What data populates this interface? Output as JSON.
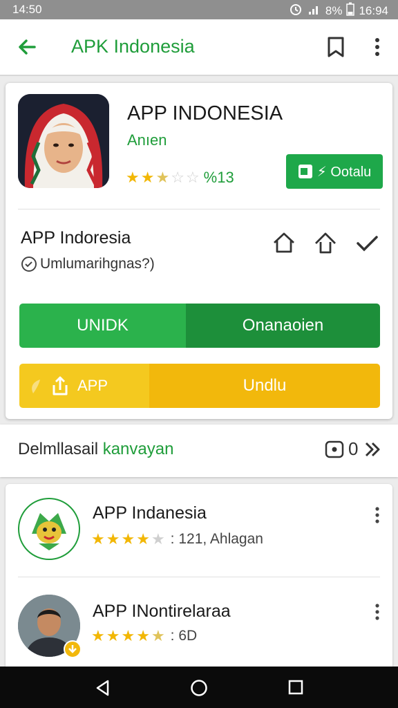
{
  "status_bar": {
    "time_left": "14:50",
    "battery": "8%",
    "time_right": "16:94"
  },
  "app_bar": {
    "title": "APK Indonesia"
  },
  "app": {
    "name": "APP INDONESIA",
    "developer": "Anıen",
    "rating_count": "%13",
    "install_label": "⚡ Ootalu"
  },
  "section": {
    "title": "APP Indoresia",
    "subtitle": "Umlumarihgnas?)"
  },
  "buttons": {
    "green_left": "UNIDK",
    "green_right": "Onanaoien",
    "yellow_left": "APP",
    "yellow_right": "Undlu"
  },
  "strip": {
    "label_dark": "Delmllasail",
    "label_green": "kanvayan",
    "count": "0"
  },
  "list": [
    {
      "title": "APP Indanesia",
      "meta": ": 121, Ahlagan",
      "rating": 4.0
    },
    {
      "title": "APP INontirelaraa",
      "meta": ": 6D",
      "rating": 4.5
    }
  ],
  "colors": {
    "brand_green": "#1f9d3a",
    "button_green": "#2bb24c",
    "button_yellow": "#f2b80c",
    "star": "#f2b705"
  }
}
